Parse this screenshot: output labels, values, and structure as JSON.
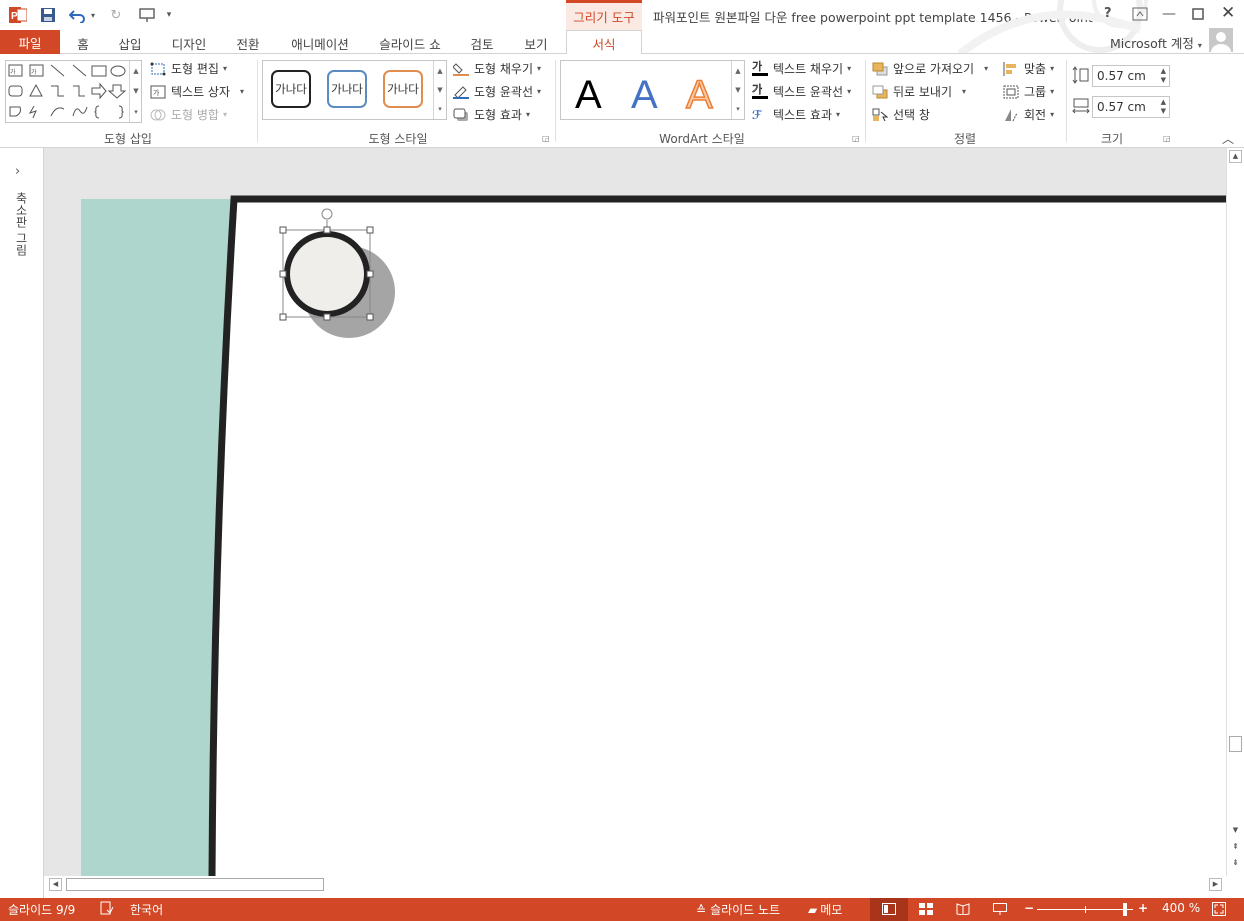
{
  "window": {
    "app_icon": "powerpoint-icon",
    "title": "파워포인트 원본파일 다운 free powerpoint ppt template 1456 - PowerPoint",
    "context_tab_group": "그리기 도구",
    "account": "Microsoft 계정",
    "help": "?",
    "controls": [
      "ribbon-display-icon",
      "minimize-icon",
      "maximize-icon",
      "close-icon"
    ]
  },
  "tabs": {
    "file": "파일",
    "home": "홈",
    "insert": "삽입",
    "design": "디자인",
    "transitions": "전환",
    "animations": "애니메이션",
    "slideshow": "슬라이드 쇼",
    "review": "검토",
    "view": "보기",
    "format": "서식"
  },
  "ribbon": {
    "insert_shapes": {
      "label": "도형 삽입",
      "edit_shape": "도형 편집",
      "text_box": "텍스트 상자",
      "merge_shapes": "도형 병합"
    },
    "shape_styles": {
      "label": "도형 스타일",
      "chip_text": "가나다",
      "chip_colors": [
        "#222222",
        "#5b8cbf",
        "#e08d4f"
      ],
      "fill": "도형 채우기",
      "outline": "도형 윤곽선",
      "effects": "도형 효과"
    },
    "wordart": {
      "label": "WordArt 스타일",
      "letter": "A",
      "letter_colors": [
        "#000000",
        "#4472c4",
        "#ed7d31"
      ],
      "text_fill": "텍스트 채우기",
      "text_outline": "텍스트 윤곽선",
      "text_effects": "텍스트 효과",
      "fill_glyph": "가",
      "outline_glyph": "가"
    },
    "arrange": {
      "label": "정렬",
      "bring_forward": "앞으로 가져오기",
      "send_backward": "뒤로 보내기",
      "selection_pane": "선택 창",
      "align": "맞춤",
      "group": "그룹",
      "rotate": "회전"
    },
    "size": {
      "label": "크기",
      "height": "0.57 cm",
      "width": "0.57 cm"
    }
  },
  "left_pane": {
    "label": "축소판 그림"
  },
  "slide": {
    "accent_color": "#afd6cc",
    "border_color": "#222222",
    "circle_fill": "#f0eeeb",
    "shadow_color": "#a5a5a5"
  },
  "status": {
    "slide_info": "슬라이드 9/9",
    "language": "한국어",
    "notes": "슬라이드 노트",
    "comments": "메모",
    "zoom": "400 %",
    "zoom_level": 0.92
  },
  "theme": {
    "brand": "#d24726"
  }
}
